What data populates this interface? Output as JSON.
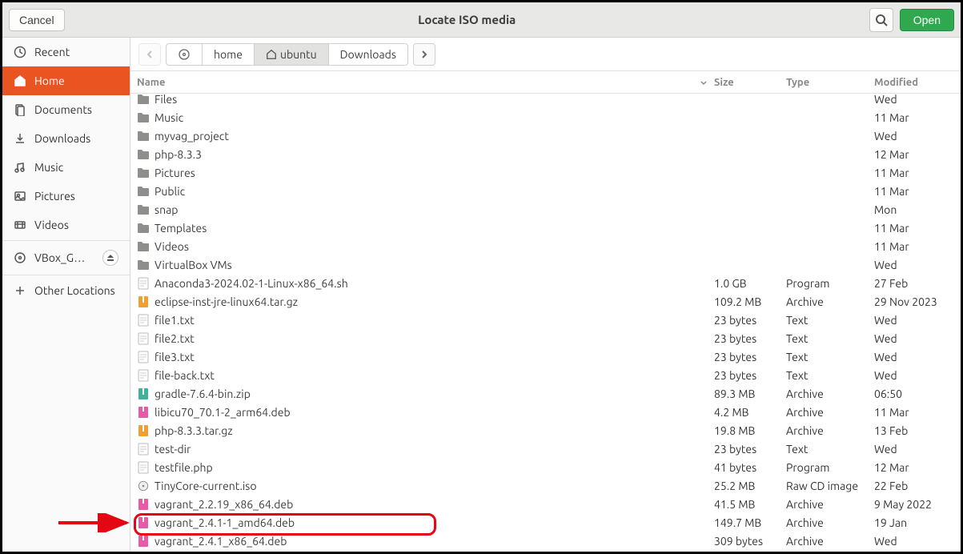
{
  "header": {
    "cancel_label": "Cancel",
    "title": "Locate ISO media",
    "open_label": "Open"
  },
  "sidebar": {
    "items": [
      {
        "icon": "clock",
        "label": "Recent"
      },
      {
        "icon": "home",
        "label": "Home",
        "selected": true
      },
      {
        "icon": "documents",
        "label": "Documents"
      },
      {
        "icon": "downloads",
        "label": "Downloads"
      },
      {
        "icon": "music",
        "label": "Music"
      },
      {
        "icon": "pictures",
        "label": "Pictures"
      },
      {
        "icon": "videos",
        "label": "Videos"
      }
    ],
    "drives": [
      {
        "icon": "disc",
        "label": "VBox_G…",
        "eject": true
      }
    ],
    "other_label": "Other Locations"
  },
  "path": {
    "segments": [
      {
        "icon": "disc",
        "label": ""
      },
      {
        "label": "home"
      },
      {
        "icon": "home",
        "label": "ubuntu",
        "current": true
      },
      {
        "label": "Downloads"
      }
    ]
  },
  "columns": {
    "name": "Name",
    "size": "Size",
    "type": "Type",
    "modified": "Modified"
  },
  "files": [
    {
      "icon": "folder",
      "name": "Files",
      "size": "",
      "type": "",
      "mod": "Wed",
      "clipped": true
    },
    {
      "icon": "folder-music",
      "name": "Music",
      "size": "",
      "type": "",
      "mod": "11 Mar"
    },
    {
      "icon": "folder",
      "name": "myvag_project",
      "size": "",
      "type": "",
      "mod": "Wed"
    },
    {
      "icon": "folder",
      "name": "php-8.3.3",
      "size": "",
      "type": "",
      "mod": "12 Mar"
    },
    {
      "icon": "folder-pic",
      "name": "Pictures",
      "size": "",
      "type": "",
      "mod": "11 Mar"
    },
    {
      "icon": "folder",
      "name": "Public",
      "size": "",
      "type": "",
      "mod": "11 Mar"
    },
    {
      "icon": "folder",
      "name": "snap",
      "size": "",
      "type": "",
      "mod": "Mon"
    },
    {
      "icon": "folder",
      "name": "Templates",
      "size": "",
      "type": "",
      "mod": "11 Mar"
    },
    {
      "icon": "folder-video",
      "name": "Videos",
      "size": "",
      "type": "",
      "mod": "11 Mar"
    },
    {
      "icon": "folder",
      "name": "VirtualBox VMs",
      "size": "",
      "type": "",
      "mod": "Wed"
    },
    {
      "icon": "text",
      "name": "Anaconda3-2024.02-1-Linux-x86_64.sh",
      "size": "1.0 GB",
      "type": "Program",
      "mod": "27 Feb"
    },
    {
      "icon": "archive",
      "name": "eclipse-inst-jre-linux64.tar.gz",
      "size": "109.2 MB",
      "type": "Archive",
      "mod": "29 Nov 2023"
    },
    {
      "icon": "text",
      "name": "file1.txt",
      "size": "23 bytes",
      "type": "Text",
      "mod": "Wed"
    },
    {
      "icon": "text",
      "name": "file2.txt",
      "size": "23 bytes",
      "type": "Text",
      "mod": "Wed"
    },
    {
      "icon": "text",
      "name": "file3.txt",
      "size": "23 bytes",
      "type": "Text",
      "mod": "Wed"
    },
    {
      "icon": "text",
      "name": "file-back.txt",
      "size": "23 bytes",
      "type": "Text",
      "mod": "Wed"
    },
    {
      "icon": "zip",
      "name": "gradle-7.6.4-bin.zip",
      "size": "89.3 MB",
      "type": "Archive",
      "mod": "06:50"
    },
    {
      "icon": "deb",
      "name": "libicu70_70.1-2_arm64.deb",
      "size": "4.2 MB",
      "type": "Archive",
      "mod": "11 Mar"
    },
    {
      "icon": "archive",
      "name": "php-8.3.3.tar.gz",
      "size": "19.8 MB",
      "type": "Archive",
      "mod": "13 Feb"
    },
    {
      "icon": "text",
      "name": "test-dir",
      "size": "23 bytes",
      "type": "Text",
      "mod": "Wed"
    },
    {
      "icon": "text",
      "name": "testfile.php",
      "size": "41 bytes",
      "type": "Program",
      "mod": "12 Mar"
    },
    {
      "icon": "disc",
      "name": "TinyCore-current.iso",
      "size": "25.2 MB",
      "type": "Raw CD image",
      "mod": "22 Feb",
      "highlight": true
    },
    {
      "icon": "deb",
      "name": "vagrant_2.2.19_x86_64.deb",
      "size": "41.5 MB",
      "type": "Archive",
      "mod": "9 May 2022"
    },
    {
      "icon": "deb",
      "name": "vagrant_2.4.1-1_amd64.deb",
      "size": "149.7 MB",
      "type": "Archive",
      "mod": "19 Jan"
    },
    {
      "icon": "deb",
      "name": "vagrant_2.4.1_x86_64.deb",
      "size": "309 bytes",
      "type": "Archive",
      "mod": "Wed"
    }
  ]
}
